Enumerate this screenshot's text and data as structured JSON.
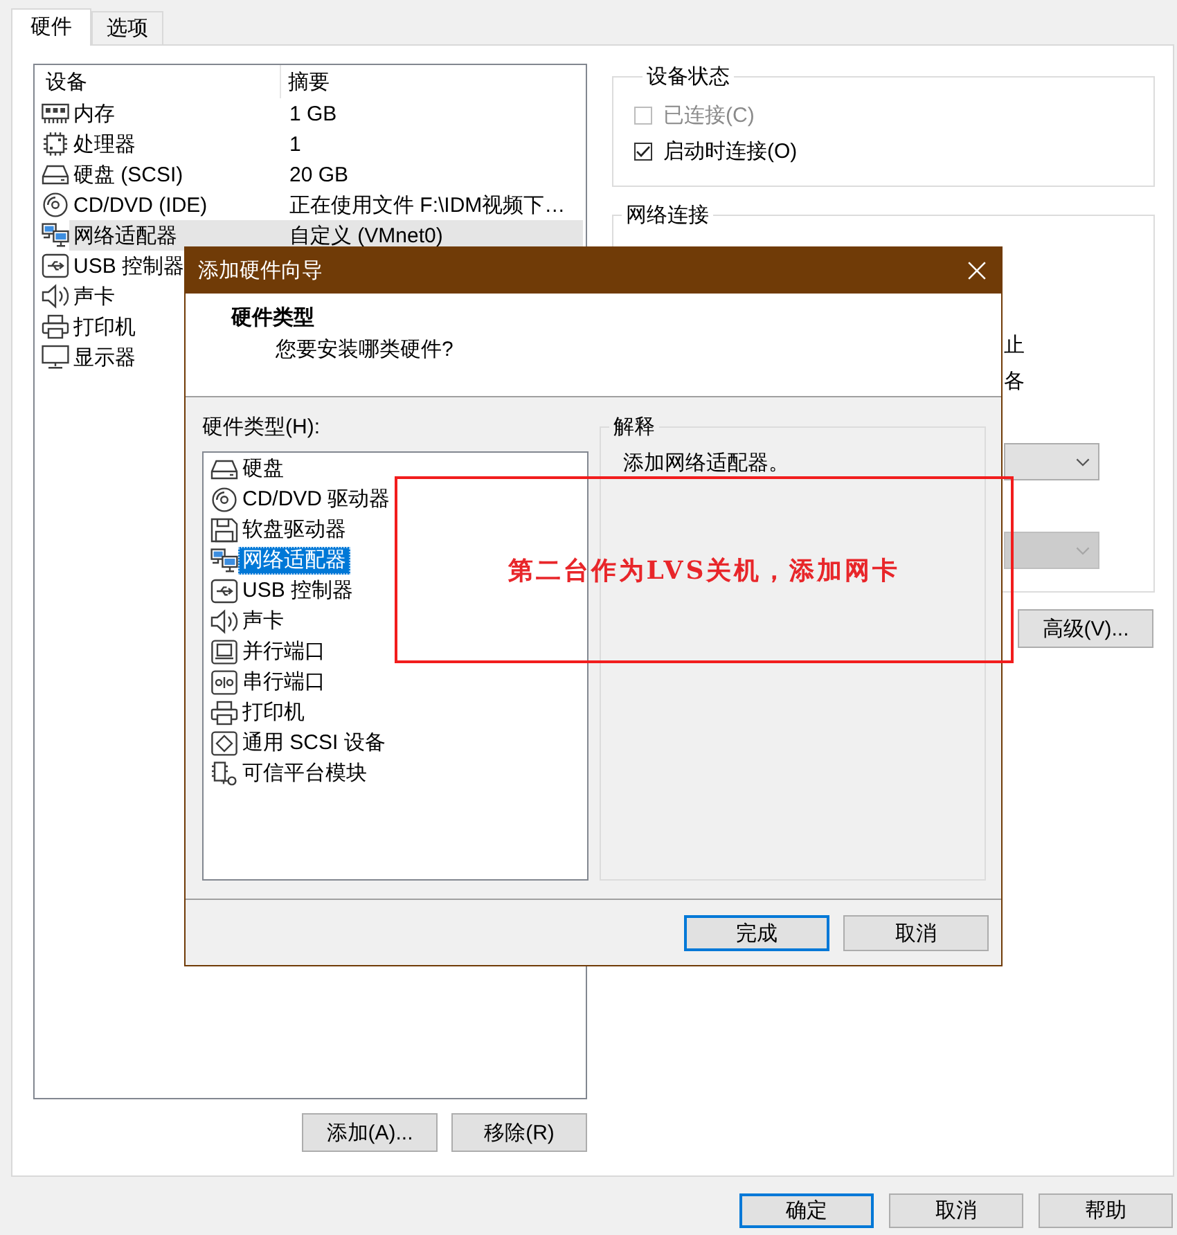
{
  "tabs": [
    {
      "label": "硬件",
      "selected": true
    },
    {
      "label": "选项",
      "selected": false
    }
  ],
  "device_list": {
    "columns": [
      "设备",
      "摘要"
    ],
    "rows": [
      {
        "kind": "memory",
        "name": "内存",
        "summary": "1 GB",
        "selected": false
      },
      {
        "kind": "processor",
        "name": "处理器",
        "summary": "1",
        "selected": false
      },
      {
        "kind": "disk",
        "name": "硬盘 (SCSI)",
        "summary": "20 GB",
        "selected": false
      },
      {
        "kind": "cdrom",
        "name": "CD/DVD (IDE)",
        "summary": "正在使用文件 F:\\IDM视频下…",
        "selected": false
      },
      {
        "kind": "network",
        "name": "网络适配器",
        "summary": "自定义 (VMnet0)",
        "selected": true
      },
      {
        "kind": "usb",
        "name": "USB 控制器",
        "selected": false
      },
      {
        "kind": "sound",
        "name": "声卡",
        "selected": false
      },
      {
        "kind": "printer",
        "name": "打印机",
        "selected": false
      },
      {
        "kind": "display",
        "name": "显示器",
        "selected": false
      }
    ]
  },
  "device_buttons": [
    {
      "label": "添加(A)..."
    },
    {
      "label": "移除(R)"
    }
  ],
  "device_status": {
    "title": "设备状态",
    "options": [
      {
        "label": "已连接(C)",
        "checked": false,
        "disabled": true
      },
      {
        "label": "启动时连接(O)",
        "checked": true,
        "disabled": false
      }
    ]
  },
  "network_connection": {
    "title": "网络连接",
    "fragments": [
      "止",
      "各"
    ],
    "dropdowns": [
      {
        "disabled": false
      },
      {
        "disabled": true
      }
    ]
  },
  "advanced_button": "高级(V)...",
  "footer_buttons": [
    {
      "label": "确定",
      "default": true
    },
    {
      "label": "取消",
      "default": false
    },
    {
      "label": "帮助",
      "default": false
    }
  ],
  "wizard": {
    "title": "添加硬件向导",
    "heading": "硬件类型",
    "subheading": "您要安装哪类硬件?",
    "list_label": "硬件类型(H):",
    "hardware_types": [
      {
        "kind": "disk",
        "label": "硬盘",
        "selected": false
      },
      {
        "kind": "cdrom",
        "label": "CD/DVD 驱动器",
        "selected": false
      },
      {
        "kind": "floppy",
        "label": "软盘驱动器",
        "selected": false
      },
      {
        "kind": "network",
        "label": "网络适配器",
        "selected": true
      },
      {
        "kind": "usb",
        "label": "USB 控制器",
        "selected": false
      },
      {
        "kind": "sound",
        "label": "声卡",
        "selected": false
      },
      {
        "kind": "parallel",
        "label": "并行端口",
        "selected": false
      },
      {
        "kind": "serial",
        "label": "串行端口",
        "selected": false
      },
      {
        "kind": "printer",
        "label": "打印机",
        "selected": false
      },
      {
        "kind": "scsi",
        "label": "通用 SCSI 设备",
        "selected": false
      },
      {
        "kind": "tpm",
        "label": "可信平台模块",
        "selected": false
      }
    ],
    "explanation": {
      "title": "解释",
      "text": "添加网络适配器。"
    },
    "buttons": [
      {
        "label": "完成",
        "default": true
      },
      {
        "label": "取消",
        "default": false
      }
    ]
  },
  "annotation": {
    "text": "第二台作为LVS关机，添加网卡"
  }
}
